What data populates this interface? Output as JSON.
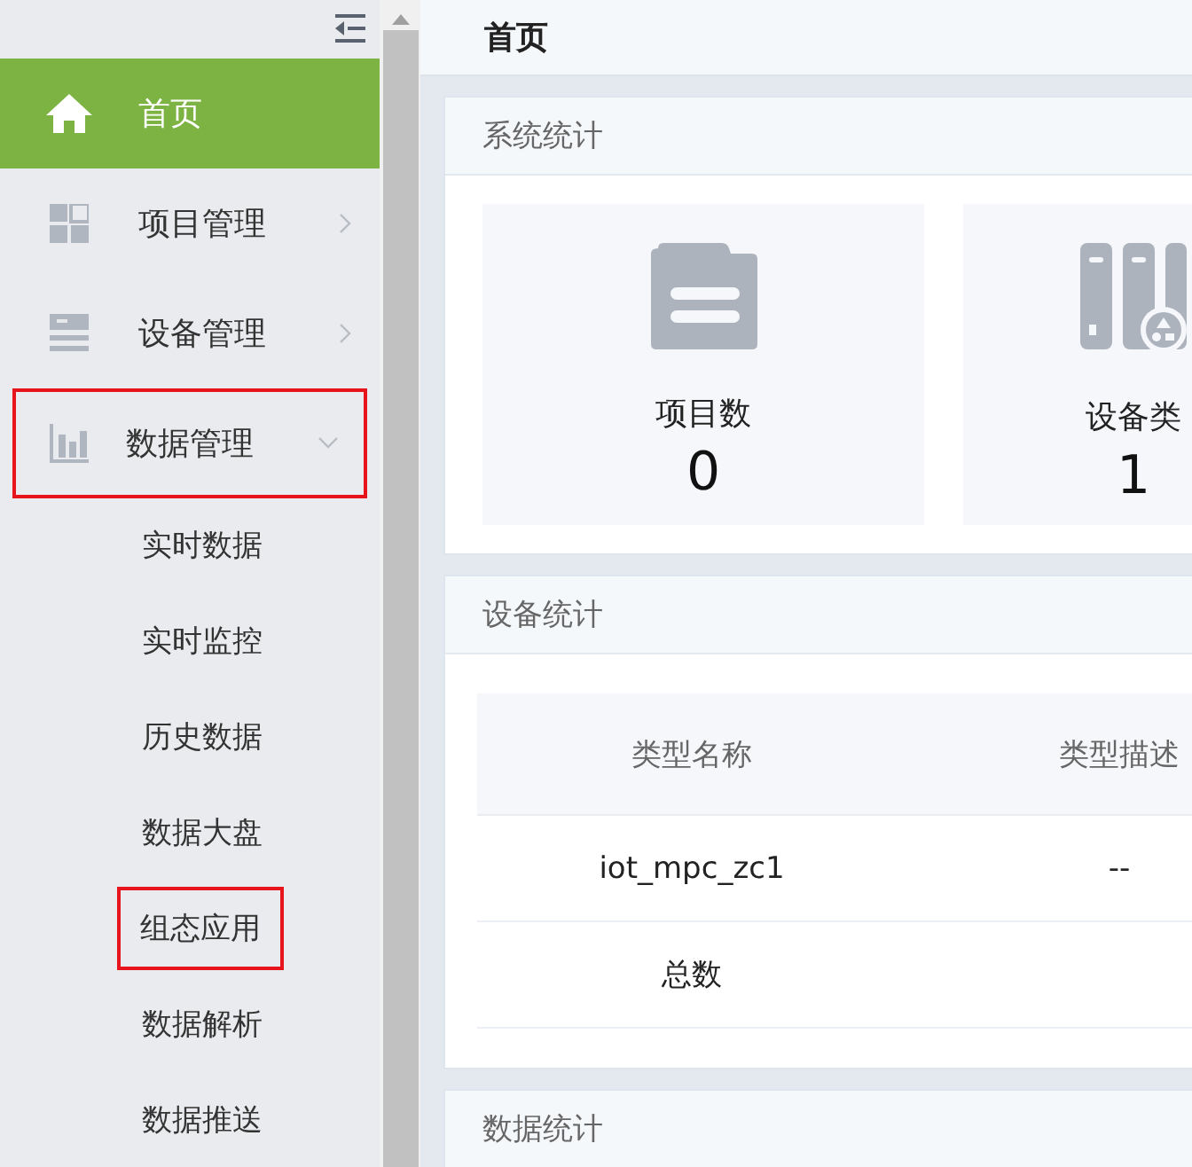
{
  "sidebar": {
    "items": [
      {
        "label": "首页",
        "kind": "link",
        "selected": true,
        "highlighted": false
      },
      {
        "label": "项目管理",
        "kind": "group",
        "expanded": false,
        "selected": false,
        "highlighted": false
      },
      {
        "label": "设备管理",
        "kind": "group",
        "expanded": false,
        "selected": false,
        "highlighted": false
      },
      {
        "label": "数据管理",
        "kind": "group",
        "expanded": true,
        "selected": false,
        "highlighted": true,
        "children": [
          {
            "label": "实时数据",
            "highlighted": false
          },
          {
            "label": "实时监控",
            "highlighted": false
          },
          {
            "label": "历史数据",
            "highlighted": false
          },
          {
            "label": "数据大盘",
            "highlighted": false
          },
          {
            "label": "组态应用",
            "highlighted": true
          },
          {
            "label": "数据解析",
            "highlighted": false
          },
          {
            "label": "数据推送",
            "highlighted": false
          }
        ]
      }
    ]
  },
  "page_title": "首页",
  "system_stats": {
    "title": "系统统计",
    "cards": [
      {
        "label": "项目数",
        "value": "0"
      },
      {
        "label": "设备类",
        "value": "1"
      }
    ]
  },
  "device_stats": {
    "title": "设备统计",
    "table": {
      "columns": [
        "类型名称",
        "类型描述"
      ],
      "rows": [
        [
          "iot_mpc_zc1",
          "--"
        ],
        [
          "总数"
        ]
      ]
    }
  },
  "data_stats": {
    "title": "数据统计"
  }
}
